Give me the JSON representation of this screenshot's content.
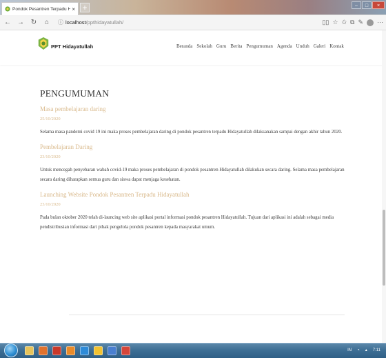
{
  "browser": {
    "tab_title": "Pondok Pesantren Terpadu Hid",
    "tab_close": "×",
    "new_tab": "+",
    "url_host": "localhost",
    "url_path": "/ppthidayatullah/",
    "win_minimize": "–",
    "win_maximize": "□",
    "win_close": "×"
  },
  "site": {
    "logo_text": "PPT Hidayatullah",
    "menu": [
      "Beranda",
      "Sekolah",
      "Guru",
      "Berita",
      "Pengumuman",
      "Agenda",
      "Unduh",
      "Galeri",
      "Kontak"
    ]
  },
  "content": {
    "page_title": "PENGUMUMAN",
    "posts": [
      {
        "title": "Masa pembelajaran daring",
        "date": "25/10/2020",
        "body": "Selama masa pandemi covid 19 ini maka proses pembelajaran daring di pondok pesantren terpadu Hidayatullah dilaksanakan sampai dengan akhir tahun 2020."
      },
      {
        "title": "Pembelajaran Daring",
        "date": "23/10/2020",
        "body": "Untuk mencegah penyebaran wabah covid-19 maka proses pembelajaran di pondok pesantren Hidayatullah dilakukan secara daring. Selama masa pembelajaran secara daring diharapkan semua guru dan siswa dapat menjaga kesehatan."
      },
      {
        "title": "Launching Website Pondok Pesantren Terpadu Hidayatullah",
        "date": "23/10/2020",
        "body": "Pada bulan oktober 2020 telah di-launcing web site aplikasi portal informasi pondok pesantren Hidayatullah. Tujuan dari aplikasi ini adalah sebagai media pendistribusian informasi dari pihak pengelola pondok pesantren kepada masyarakat umum."
      }
    ]
  },
  "taskbar": {
    "tray_lang": "IN",
    "tray_time": "7:11"
  },
  "colors": {
    "post_title": "#d9b98b",
    "taskbar": "#3e6f95"
  }
}
